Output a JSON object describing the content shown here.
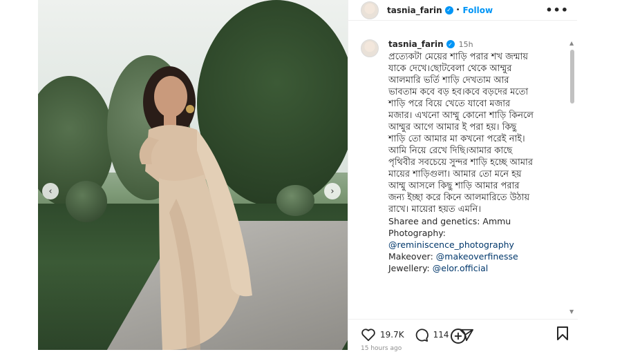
{
  "header": {
    "username": "tasnia_farin",
    "separator": "•",
    "follow_label": "Follow",
    "more_label": "•••"
  },
  "caption": {
    "username": "tasnia_farin",
    "time": "15h",
    "lines": [
      "প্রত্যেকটা মেয়ের শাড়ি পরার শখ জন্মায়",
      "যাকে দেখে।ছোটবেলা থেকে আম্মুর",
      "আলমারি ভর্তি শাড়ি দেখতাম আর",
      "ভাবতাম কবে বড় হব।কবে বড়দের মতো",
      "শাড়ি পরে বিয়ে খেতে যাবো মজার",
      "মজার। এখনো আম্মু কোনো শাড়ি কিনলে",
      "আম্মুর আগে আমার ই পরা হয়। কিছু",
      "শাড়ি তো আমার মা কখনো পরেই নাই।",
      "আমি নিয়ে রেখে দিছি।আমার কাছে",
      "পৃথিবীর সবচেয়ে সুন্দর শাড়ি হচ্ছে আমার",
      "মায়ের শাড়িগুলা। আমার তো মনে হয়",
      "আম্মু আসলে কিছু শাড়ি আমার পরার",
      "জন্য ইচ্ছা করে কিনে আলমারিতে উঠায়",
      "রাখে। মায়েরা হয়ত এমনি।"
    ],
    "credit_sharee": "Sharee and genetics: Ammu",
    "credit_photo_label": "Photography:",
    "credit_photo_link": "@reminiscence_photography",
    "credit_makeover_label": "Makeover: ",
    "credit_makeover_link": "@makeoverfinesse",
    "credit_jewellery_label": "Jewellery: ",
    "credit_jewellery_link": "@elor.official"
  },
  "actions": {
    "likes": "19.7K",
    "comments": "114"
  },
  "footer": {
    "posted": "15 hours ago"
  },
  "nav": {
    "prev": "‹",
    "next": "›"
  },
  "colors": {
    "accent": "#0095f6",
    "link": "#00376b"
  }
}
